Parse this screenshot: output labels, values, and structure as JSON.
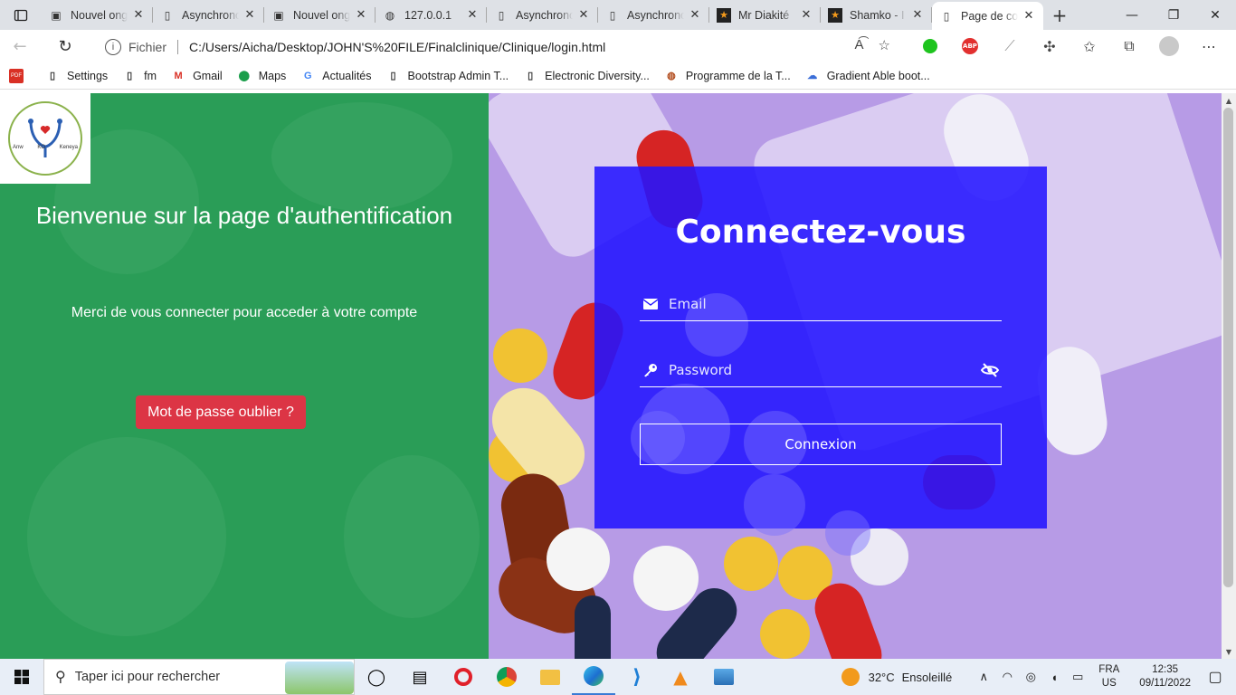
{
  "browser": {
    "tabs": [
      {
        "title": "Nouvel onglet",
        "icon": "page-icon"
      },
      {
        "title": "Asynchronous",
        "icon": "doc-icon"
      },
      {
        "title": "Nouvel onglet",
        "icon": "page-icon"
      },
      {
        "title": "127.0.0.1",
        "icon": "globe-icon"
      },
      {
        "title": "Asynchronous",
        "icon": "doc-icon"
      },
      {
        "title": "Asynchronous",
        "icon": "doc-icon"
      },
      {
        "title": "Mr Diakité",
        "icon": "star-icon"
      },
      {
        "title": "Shamko - I",
        "icon": "star-icon"
      },
      {
        "title": "Page de connexion",
        "icon": "doc-icon",
        "active": true
      }
    ],
    "address": {
      "scheme": "Fichier",
      "url": "C:/Users/Aicha/Desktop/JOHN'S%20FILE/Finalclinique/Clinique/login.html"
    },
    "bookmarks": [
      {
        "label": "Settings",
        "icon": "doc-icon"
      },
      {
        "label": "fm",
        "icon": "doc-icon"
      },
      {
        "label": "Gmail",
        "icon": "gmail-icon"
      },
      {
        "label": "Maps",
        "icon": "maps-icon"
      },
      {
        "label": "Actualités",
        "icon": "news-icon"
      },
      {
        "label": "Bootstrap Admin T...",
        "icon": "doc-icon"
      },
      {
        "label": "Electronic Diversity...",
        "icon": "doc-icon"
      },
      {
        "label": "Programme de la T...",
        "icon": "globe-icon"
      },
      {
        "label": "Gradient Able boot...",
        "icon": "cloud-icon"
      }
    ]
  },
  "page": {
    "logo": {
      "left_text": "Anw",
      "middle_text": "KO",
      "right_text": "Keneya"
    },
    "welcome_title": "Bienvenue sur la page d'authentification",
    "welcome_subtitle": "Merci de vous connecter pour acceder à votre compte",
    "forgot_button": "Mot de passe oublier ?",
    "login": {
      "title": "Connectez-vous",
      "email_placeholder": "Email",
      "password_placeholder": "Password",
      "submit_label": "Connexion"
    },
    "colors": {
      "left_bg": "#2a9d57",
      "card_bg": "#2314ff",
      "forgot_btn": "#dc3545"
    }
  },
  "taskbar": {
    "search_placeholder": "Taper ici pour rechercher",
    "weather": {
      "temp": "32°C",
      "condition": "Ensoleillé"
    },
    "lang": {
      "line1": "FRA",
      "line2": "US"
    },
    "clock": {
      "time": "12:35",
      "date": "09/11/2022"
    }
  }
}
